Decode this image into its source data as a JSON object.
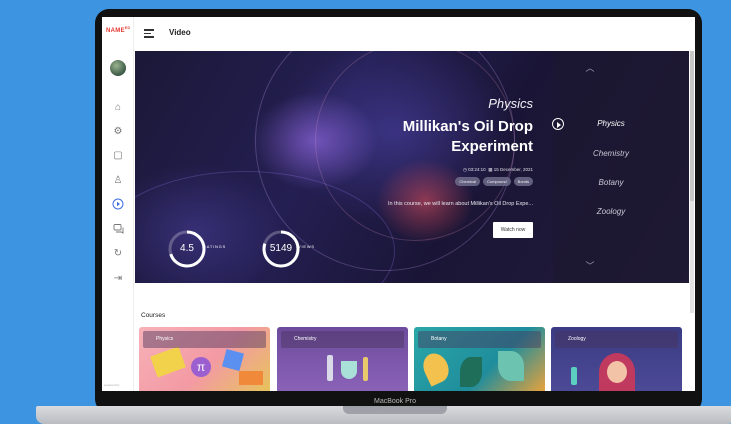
{
  "app": {
    "logo": "NAME",
    "logo_sup": "ED",
    "page_title": "Video",
    "device_label": "MacBook Pro",
    "sidebar_footer": "powered by"
  },
  "sidebar": {
    "items": [
      {
        "name": "home-icon",
        "glyph": "⌂"
      },
      {
        "name": "settings-icon",
        "glyph": "⚙"
      },
      {
        "name": "book-icon",
        "glyph": "▢"
      },
      {
        "name": "people-icon",
        "glyph": "♙"
      },
      {
        "name": "play-circle-icon",
        "glyph": "▶",
        "active": true
      },
      {
        "name": "chat-icon",
        "glyph": "◻"
      },
      {
        "name": "history-icon",
        "glyph": "↻"
      },
      {
        "name": "logout-icon",
        "glyph": "⇥"
      }
    ]
  },
  "hero": {
    "subject": "Physics",
    "title": "Millikan's Oil Drop Experiment",
    "duration": "03:24:10",
    "date": "15 December, 2021",
    "tags": [
      "Chemical",
      "Compound",
      "Bonds"
    ],
    "description": "In this course, we will learn about Millikan's Oil Drop Expe...",
    "watch_label": "Watch now",
    "ratings": {
      "value": "4.5",
      "label": "RATINGS",
      "fraction": 0.7
    },
    "views": {
      "value": "5149",
      "label": "VIEWS",
      "fraction": 0.8
    },
    "subjects": [
      "Physics",
      "Chemistry",
      "Botany",
      "Zoology"
    ],
    "current_subject": "Physics"
  },
  "courses": {
    "title": "Courses",
    "cards": [
      {
        "label": "Physics"
      },
      {
        "label": "Chemistry"
      },
      {
        "label": "Botany"
      },
      {
        "label": "Zoology"
      }
    ]
  },
  "colors": {
    "background": "#3d95e1",
    "accent": "#3d6fe0",
    "brand": "#e5372f"
  }
}
